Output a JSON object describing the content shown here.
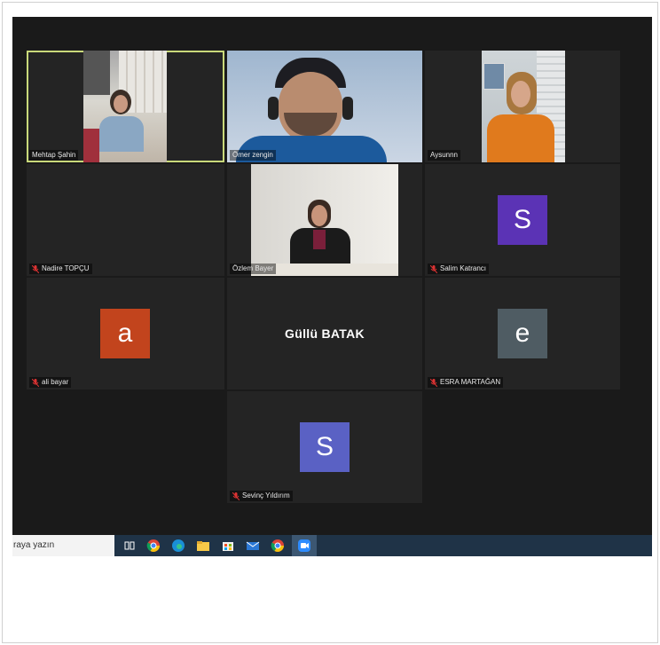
{
  "meeting": {
    "participants": [
      {
        "id": "mehtap",
        "name": "Mehtap Şahin",
        "muted": false,
        "active": true
      },
      {
        "id": "omer",
        "name": "Ömer zengin",
        "muted": false
      },
      {
        "id": "aysun",
        "name": "Aysunnn",
        "muted": false
      },
      {
        "id": "nadire",
        "name": "Nadire TOPÇU",
        "muted": true
      },
      {
        "id": "ozlem",
        "name": "Özlem Bayer",
        "muted": false
      },
      {
        "id": "salim",
        "name": "Salim Katrancı",
        "muted": true,
        "initial": "S",
        "color": "#5b33b5"
      },
      {
        "id": "ali",
        "name": "ali bayar",
        "muted": true,
        "initial": "a",
        "color": "#c2441d"
      },
      {
        "id": "gullu",
        "name": "Güllü BATAK",
        "display": "name-only"
      },
      {
        "id": "esra",
        "name": "ESRA MARTAĞAN",
        "muted": true,
        "initial": "e",
        "color": "#4f5c63"
      },
      {
        "id": "sevinc",
        "name": "Sevinç Yıldırım",
        "muted": true,
        "initial": "S",
        "color": "#5a61c4"
      }
    ]
  },
  "taskbar": {
    "search_text": "raya yazın",
    "icons": [
      "task-view-icon",
      "chrome-icon",
      "edge-icon",
      "file-explorer-icon",
      "store-icon",
      "mail-icon",
      "chrome-icon",
      "zoom-icon"
    ]
  },
  "colors": {
    "active_speaker_border": "#c9d97a",
    "taskbar_bg": "#1f3347",
    "screen_bg": "#1a1a1a",
    "tile_bg": "#242424"
  }
}
